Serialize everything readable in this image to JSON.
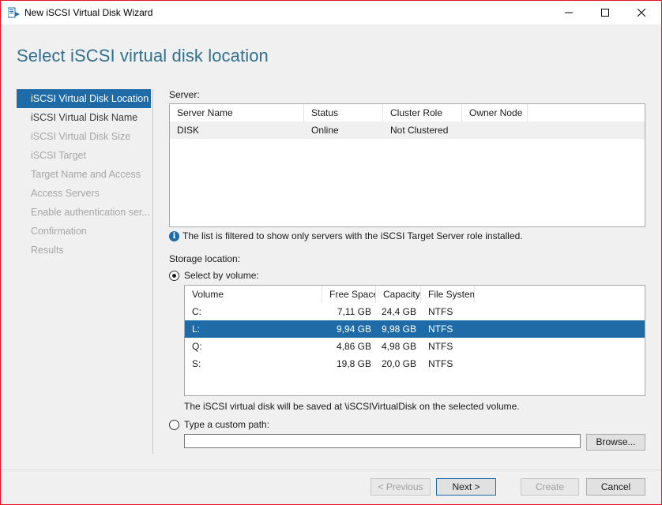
{
  "window": {
    "title": "New iSCSI Virtual Disk Wizard",
    "minimize_glyph": "—",
    "maximize_glyph": "☐",
    "close_glyph": "✕"
  },
  "page": {
    "title": "Select iSCSI virtual disk location"
  },
  "nav": {
    "items": [
      {
        "label": "iSCSI Virtual Disk Location",
        "state": "active"
      },
      {
        "label": "iSCSI Virtual Disk Name",
        "state": "normal"
      },
      {
        "label": "iSCSI Virtual Disk Size",
        "state": "disabled"
      },
      {
        "label": "iSCSI Target",
        "state": "disabled"
      },
      {
        "label": "Target Name and Access",
        "state": "disabled"
      },
      {
        "label": "Access Servers",
        "state": "disabled"
      },
      {
        "label": "Enable authentication ser...",
        "state": "disabled"
      },
      {
        "label": "Confirmation",
        "state": "disabled"
      },
      {
        "label": "Results",
        "state": "disabled"
      }
    ]
  },
  "server": {
    "label": "Server:",
    "columns": [
      "Server Name",
      "Status",
      "Cluster Role",
      "Owner Node"
    ],
    "rows": [
      [
        "DISK",
        "Online",
        "Not Clustered",
        ""
      ]
    ],
    "info_text": "The list is filtered to show only servers with the iSCSI Target Server role installed."
  },
  "storage": {
    "label": "Storage location:",
    "select_by_volume_label": "Select by volume:",
    "columns": [
      "Volume",
      "Free Space",
      "Capacity",
      "File System"
    ],
    "rows": [
      [
        "C:",
        "7,11 GB",
        "24,4 GB",
        "NTFS"
      ],
      [
        "L:",
        "9,94 GB",
        "9,98 GB",
        "NTFS"
      ],
      [
        "Q:",
        "4,86 GB",
        "4,98 GB",
        "NTFS"
      ],
      [
        "S:",
        "19,8 GB",
        "20,0 GB",
        "NTFS"
      ]
    ],
    "selected_volume": "L:",
    "save_note": "The iSCSI virtual disk will be saved at \\iSCSIVirtualDisk on the selected volume.",
    "custom_path_label": "Type a custom path:",
    "custom_path_value": "",
    "browse_label": "Browse..."
  },
  "footer": {
    "previous_label": "< Previous",
    "next_label": "Next >",
    "create_label": "Create",
    "cancel_label": "Cancel"
  },
  "colors": {
    "accent": "#1e6ba8",
    "title": "#31708f",
    "window_border": "#e81123"
  }
}
